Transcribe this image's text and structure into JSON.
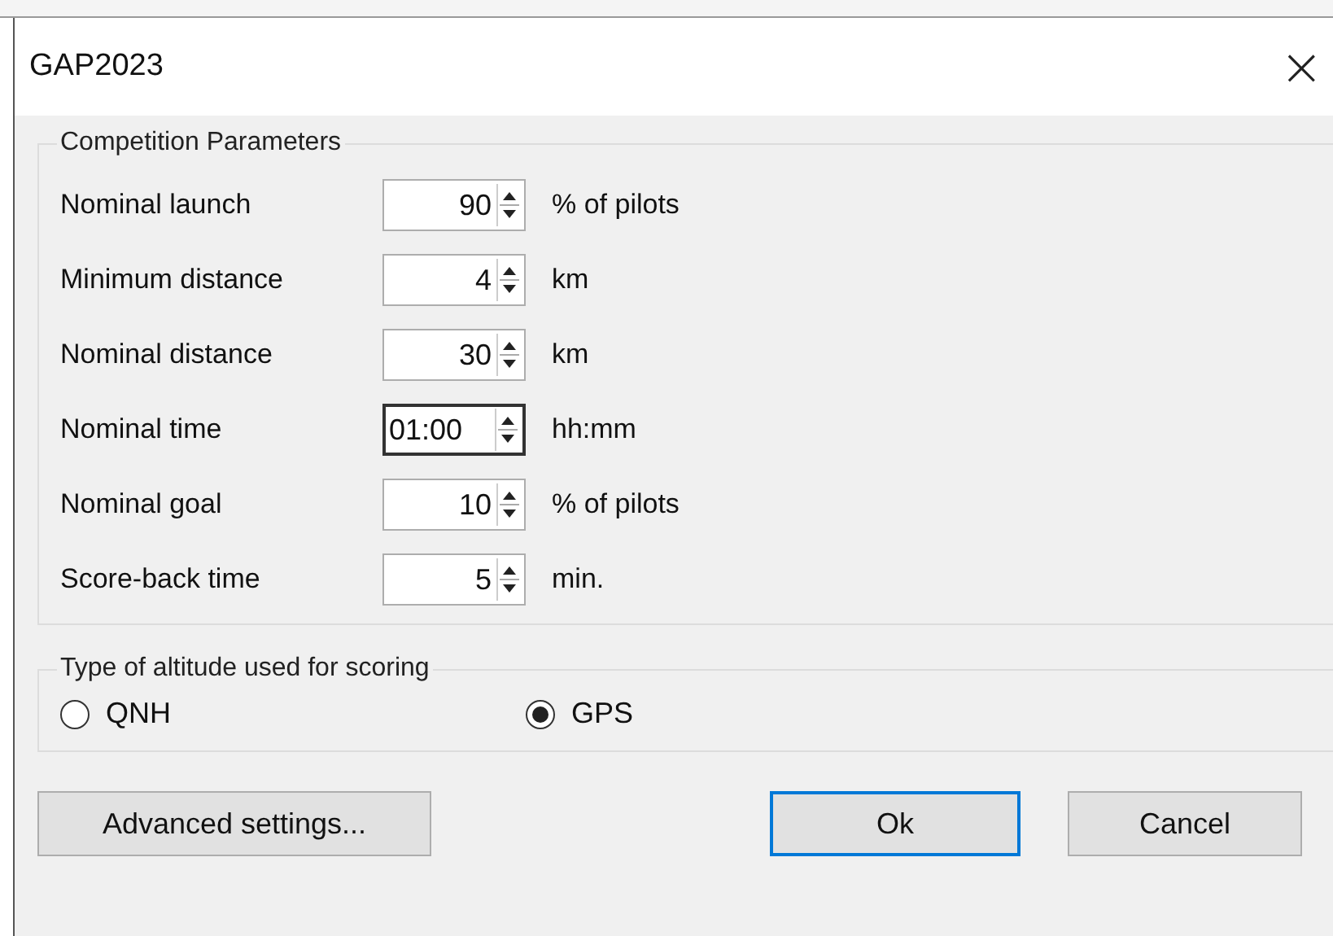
{
  "window": {
    "title": "GAP2023",
    "close": "×"
  },
  "competition_parameters": {
    "title": "Competition Parameters",
    "rows": [
      {
        "label": "Nominal launch",
        "value": "90",
        "kind": "number",
        "focused": false,
        "unit": "% of pilots"
      },
      {
        "label": "Minimum distance",
        "value": "4",
        "kind": "number",
        "focused": false,
        "unit": "km"
      },
      {
        "label": "Nominal distance",
        "value": "30",
        "kind": "number",
        "focused": false,
        "unit": "km"
      },
      {
        "label": "Nominal time",
        "value": "01:00",
        "kind": "time",
        "focused": true,
        "unit": "hh:mm"
      },
      {
        "label": "Nominal goal",
        "value": "10",
        "kind": "number",
        "focused": false,
        "unit": "% of pilots"
      },
      {
        "label": "Score-back time",
        "value": "5",
        "kind": "number",
        "focused": false,
        "unit": "min."
      }
    ]
  },
  "altitude_type": {
    "title": "Type of altitude used for scoring",
    "options": [
      {
        "label": "QNH",
        "selected": false
      },
      {
        "label": "GPS",
        "selected": true
      }
    ]
  },
  "buttons": [
    {
      "label": "Advanced settings...",
      "default": false
    },
    {
      "label": "Ok",
      "default": true
    },
    {
      "label": "Cancel",
      "default": false
    }
  ]
}
